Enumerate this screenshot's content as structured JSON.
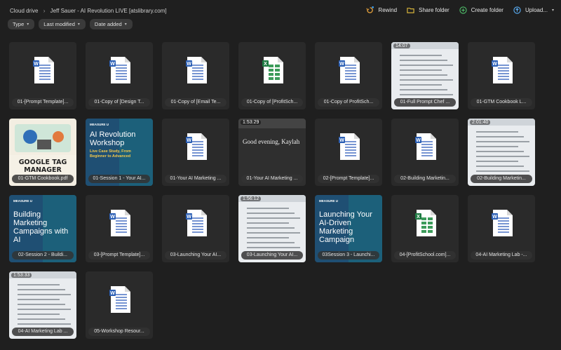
{
  "breadcrumb": {
    "root": "Cloud drive",
    "path": "Jeff Sauer - AI Revolution LIVE [atslibrary.com]"
  },
  "actions": {
    "rewind": "Rewind",
    "share": "Share folder",
    "create": "Create folder",
    "upload": "Upload..."
  },
  "filters": [
    "Type",
    "Last modified",
    "Date added"
  ],
  "tiles": [
    {
      "name": "01-[Prompt Template]...",
      "kind": "word"
    },
    {
      "name": "01-Copy of [Design T...",
      "kind": "word"
    },
    {
      "name": "01-Copy of [Email Te...",
      "kind": "word"
    },
    {
      "name": "01-Copy of [ProfitSch...",
      "kind": "excel"
    },
    {
      "name": "01-Copy of ProfitSch...",
      "kind": "word"
    },
    {
      "name": "01-Full Prompt Chef ...",
      "kind": "video",
      "duration": "14:07"
    },
    {
      "name": "01-GTM Cookbook L...",
      "kind": "word"
    },
    {
      "name": "01-GTM Cookbook.pdf",
      "kind": "image",
      "text": "GOOGLE TAG MANAGER"
    },
    {
      "name": "01-Session 1 - Your AI...",
      "kind": "image",
      "text": "AI Revolution Workshop",
      "sub": "Live Case Study, From Beginner to Advanced",
      "brand": "MEASURE U"
    },
    {
      "name": "01-Your AI Marketing ...",
      "kind": "word"
    },
    {
      "name": "01-Your AI Marketing ...",
      "kind": "video",
      "duration": "1:53:29",
      "text": "Good evening, Kaylah"
    },
    {
      "name": "02-[Prompt Template]...",
      "kind": "word"
    },
    {
      "name": "02-Building Marketin...",
      "kind": "word"
    },
    {
      "name": "02-Building Marketin...",
      "kind": "video",
      "duration": "2:01:40"
    },
    {
      "name": "02-Session 2 - Buildi...",
      "kind": "image",
      "text": "Building Marketing Campaigns with AI",
      "brand": "MEASURE U"
    },
    {
      "name": "03-[Prompt Template]...",
      "kind": "word"
    },
    {
      "name": "03-Launching Your AI...",
      "kind": "word"
    },
    {
      "name": "03-Launching Your AI...",
      "kind": "video",
      "duration": "1:56:12"
    },
    {
      "name": "03Session 3 - Launchi...",
      "kind": "image",
      "text": "Launching Your AI-Driven Marketing Campaign",
      "brand": "MEASURE U"
    },
    {
      "name": "04-[ProfitSchool.com]...",
      "kind": "excel"
    },
    {
      "name": "04-AI Marketing Lab -...",
      "kind": "word"
    },
    {
      "name": "04-AI Marketing Lab ...",
      "kind": "video",
      "duration": "1:53:33"
    },
    {
      "name": "05-Workshop Resour...",
      "kind": "word"
    }
  ]
}
